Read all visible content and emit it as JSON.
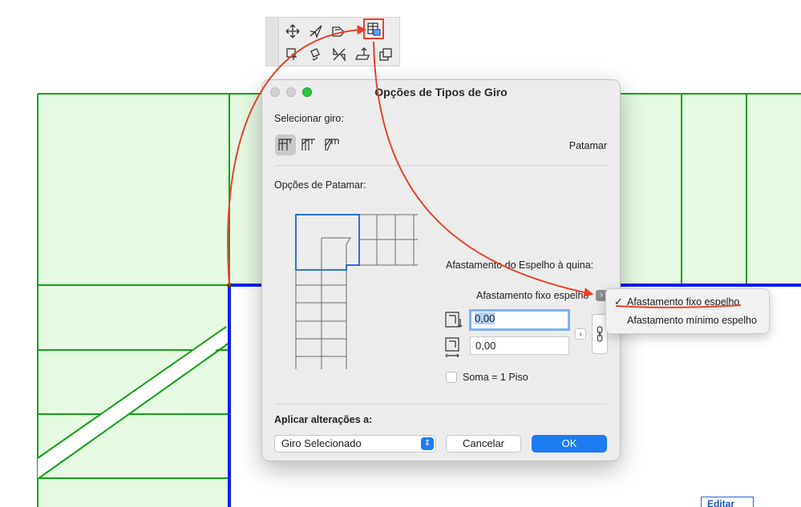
{
  "dialog": {
    "title": "Opções de Tipos de Giro",
    "select_label": "Selecionar giro:",
    "selected_type_name": "Patamar",
    "options_label": "Opções de Patamar:",
    "offset_label": "Afastamento do Espelho à quina:",
    "offset_mode_value": "Afastamento fixo espelho",
    "field1_value": "0,00",
    "field2_value": "0,00",
    "sum_checkbox_label": "Soma = 1 Piso",
    "apply_label": "Aplicar alterações a:",
    "apply_select_value": "Giro Selecionado",
    "cancel_label": "Cancelar",
    "ok_label": "OK"
  },
  "menu": {
    "items": [
      {
        "label": "Afastamento fixo espelho",
        "checked": true
      },
      {
        "label": "Afastamento mínimo espelho",
        "checked": false
      }
    ]
  },
  "floor_plan": {
    "editar_label": "Editar"
  },
  "colors": {
    "fill": "#e6f9e2",
    "wall_green": "#0fa312",
    "beam_blue": "#0a1ef0",
    "annotation_red": "#e8412c",
    "accent_blue": "#1d7bf0"
  },
  "icons": {
    "toolbar": [
      "move-icon",
      "drag-icon",
      "slab-edit-icon",
      "turning-type-icon",
      "offset-icon",
      "rotate-icon",
      "mirror-icon",
      "elevate-icon",
      "duplicate-icon"
    ]
  }
}
